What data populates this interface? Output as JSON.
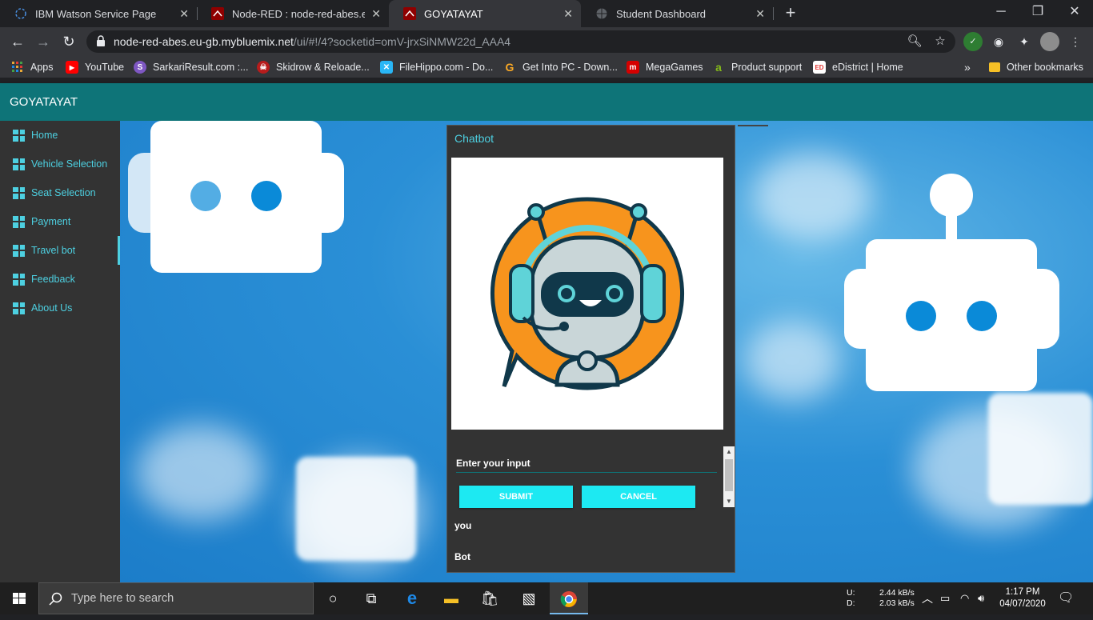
{
  "browser": {
    "tabs": [
      {
        "title": "IBM Watson Service Page",
        "active": false,
        "icon": "ibm-watson-icon"
      },
      {
        "title": "Node-RED : node-red-abes.eu-gb",
        "active": false,
        "icon": "node-red-icon"
      },
      {
        "title": "GOYATAYAT",
        "active": true,
        "icon": "node-red-icon"
      },
      {
        "title": "Student Dashboard",
        "active": false,
        "icon": "globe-icon"
      }
    ],
    "url_host": "node-red-abes.eu-gb.mybluemix.net",
    "url_path": "/ui/#!/4?socketid=omV-jrxSiNMW22d_AAA4",
    "bookmarks": [
      {
        "label": "Apps",
        "icon": "apps-grid-icon",
        "color": "#e8eaed"
      },
      {
        "label": "YouTube",
        "icon": "youtube-icon",
        "color": "#ff0000"
      },
      {
        "label": "SarkariResult.com :...",
        "icon": "sarkariresult-icon",
        "color": "#7e57c2"
      },
      {
        "label": "Skidrow & Reloade...",
        "icon": "skidrow-icon",
        "color": "#b71c1c"
      },
      {
        "label": "FileHippo.com - Do...",
        "icon": "filehippo-icon",
        "color": "#29b6f6"
      },
      {
        "label": "Get Into PC - Down...",
        "icon": "getintopc-icon",
        "color": "#f9a825"
      },
      {
        "label": "MegaGames",
        "icon": "megagames-icon",
        "color": "#d50000"
      },
      {
        "label": "Product support",
        "icon": "acer-icon",
        "color": "#83b81a"
      },
      {
        "label": "eDistrict | Home",
        "icon": "edistrict-icon",
        "color": "#e53935"
      }
    ],
    "other_bookmarks": "Other bookmarks",
    "overflow": "»"
  },
  "app": {
    "title": "GOYATAYAT",
    "nav": [
      {
        "label": "Home",
        "active": false
      },
      {
        "label": "Vehicle Selection",
        "active": false
      },
      {
        "label": "Seat Selection",
        "active": false
      },
      {
        "label": "Payment",
        "active": false
      },
      {
        "label": "Travel bot",
        "active": true
      },
      {
        "label": "Feedback",
        "active": false
      },
      {
        "label": "About Us",
        "active": false
      }
    ],
    "accent": "#4dd0e1",
    "header_color": "#0e7478"
  },
  "chatbot": {
    "title": "Chatbot",
    "input_placeholder": "Enter your input",
    "input_value": "",
    "submit_label": "SUBMIT",
    "cancel_label": "CANCEL",
    "user_label": "you",
    "bot_label": "Bot",
    "button_color": "#1de9f2"
  },
  "taskbar": {
    "search_placeholder": "Type here to search",
    "net_up_label": "U:",
    "net_down_label": "D:",
    "net_up": "2.44 kB/s",
    "net_down": "2.03 kB/s",
    "time": "1:17 PM",
    "date": "04/07/2020"
  }
}
